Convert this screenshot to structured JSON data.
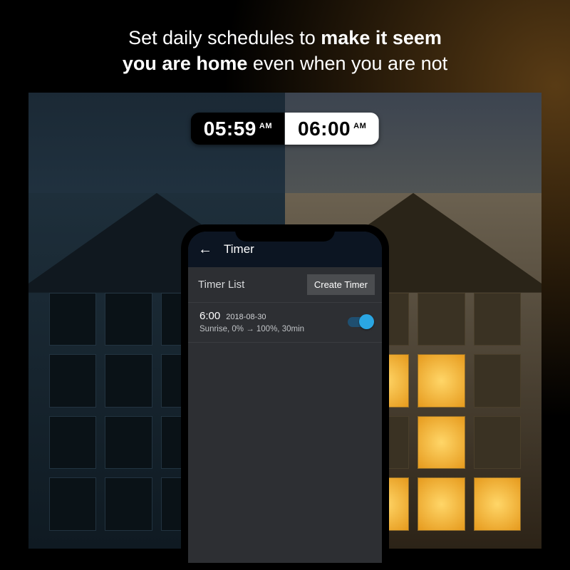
{
  "headline": {
    "prefix": "Set daily schedules to ",
    "bold1": "make it seem",
    "bold2": "you are home",
    "suffix": " even when you are not"
  },
  "clock": {
    "left": {
      "time": "05:59",
      "ampm": "AM"
    },
    "right": {
      "time": "06:00",
      "ampm": "AM"
    }
  },
  "app": {
    "title": "Timer",
    "list_label": "Timer List",
    "create_label": "Create Timer",
    "timers": [
      {
        "time": "6:00",
        "date": "2018-08-30",
        "detail": "Sunrise, 0% → 100%, 30min",
        "enabled": true
      }
    ]
  }
}
